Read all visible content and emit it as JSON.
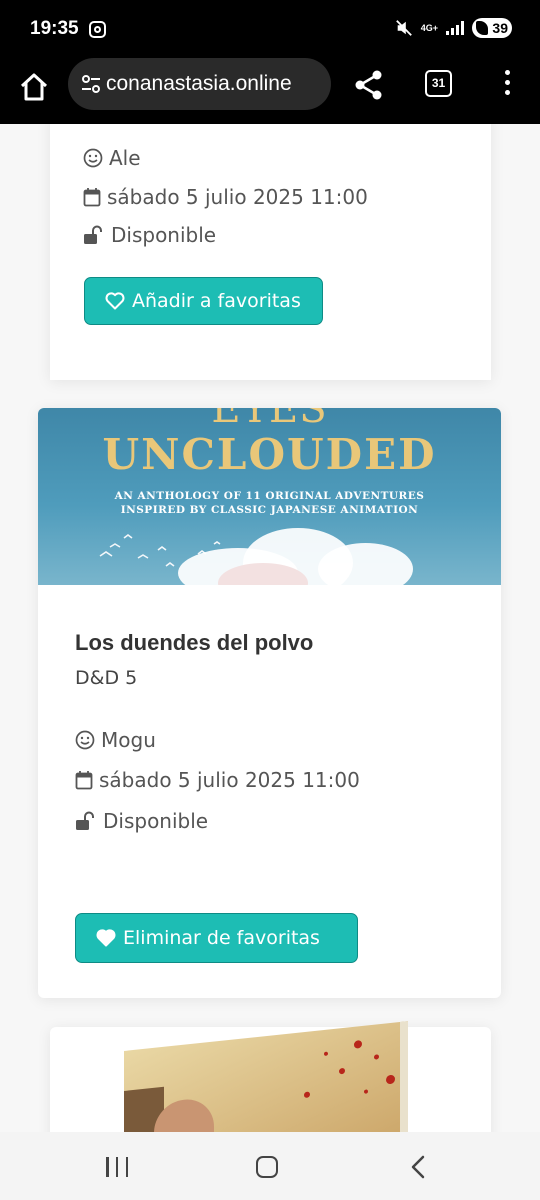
{
  "status_bar": {
    "time": "19:35",
    "network": "4G+",
    "battery": "39"
  },
  "browser": {
    "url": "conanastasia.online",
    "tab_count": "31"
  },
  "cards": [
    {
      "gm": "Ale",
      "date": "sábado 5 julio 2025 11:00",
      "status": "Disponible",
      "fav_button": "Añadir a favoritas"
    },
    {
      "banner": {
        "title_top": "EYES",
        "title": "UNCLOUDED",
        "subtitle_line1": "AN ANTHOLOGY OF 11 ORIGINAL ADVENTURES",
        "subtitle_line2": "INSPIRED BY CLASSIC JAPANESE ANIMATION"
      },
      "title": "Los duendes del polvo",
      "system": "D&D 5",
      "gm": "Mogu",
      "date": "sábado 5 julio 2025 11:00",
      "status": "Disponible",
      "fav_button": "Eliminar de favoritas"
    }
  ],
  "colors": {
    "accent": "#1dbdb4",
    "accent_border": "#0e8b85",
    "banner_gold": "#e9c779"
  }
}
